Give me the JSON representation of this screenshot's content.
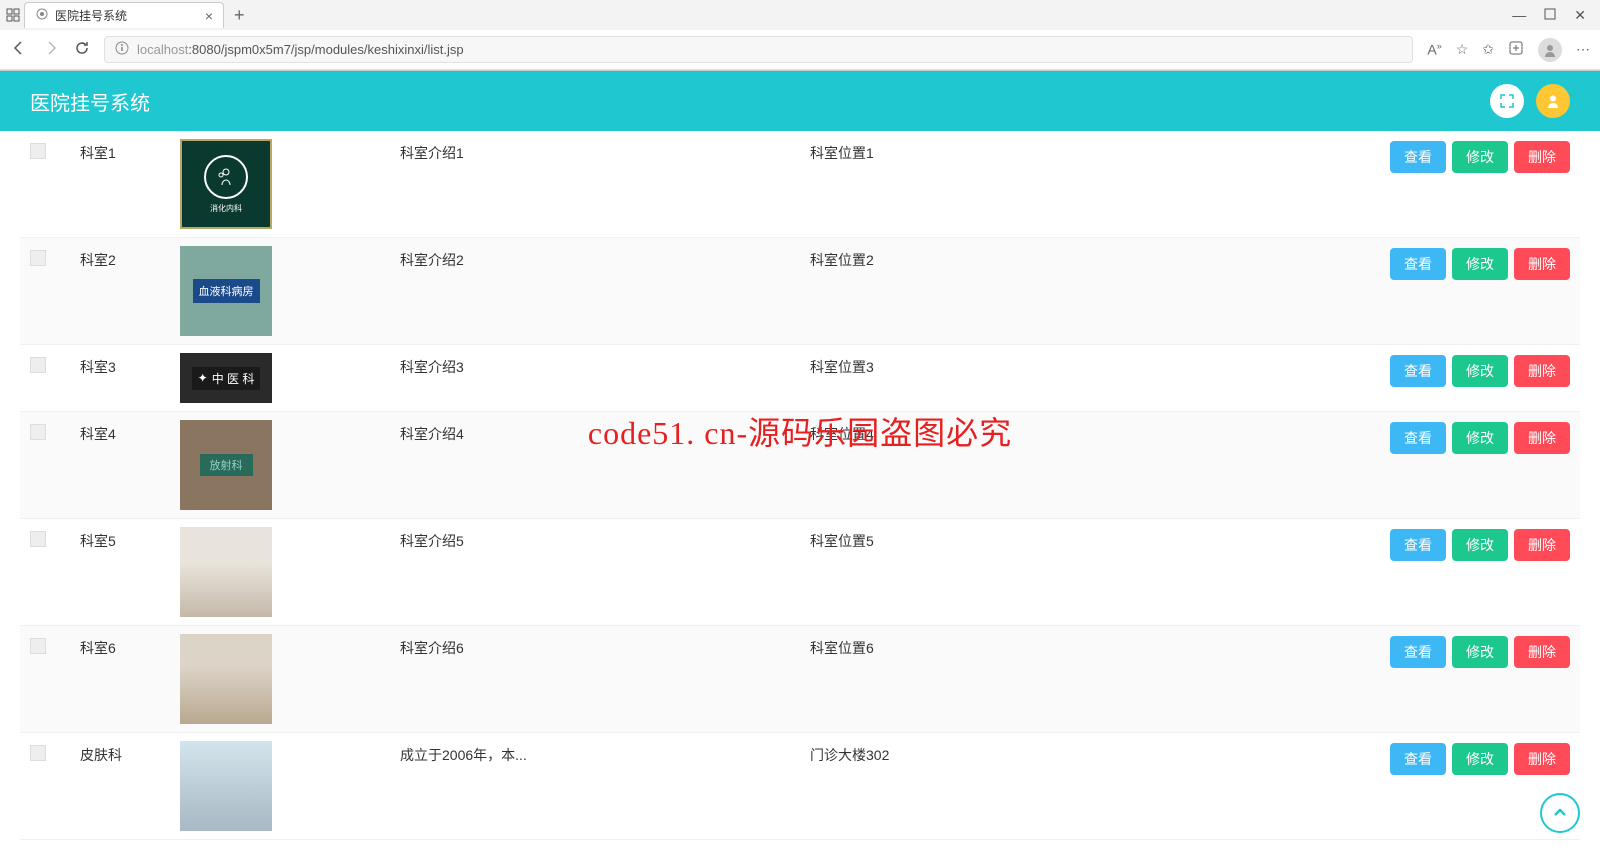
{
  "browser": {
    "tab_title": "医院挂号系统",
    "url_host": "localhost",
    "url_path": ":8080/jspm0x5m7/jsp/modules/keshixinxi/list.jsp"
  },
  "header": {
    "title": "医院挂号系统"
  },
  "actions": {
    "view": "查看",
    "edit": "修改",
    "delete": "删除"
  },
  "rows": [
    {
      "name": "科室1",
      "intro": "科室介绍1",
      "location": "科室位置1",
      "thumb_label": "消化内科"
    },
    {
      "name": "科室2",
      "intro": "科室介绍2",
      "location": "科室位置2",
      "thumb_label": "血液科病房"
    },
    {
      "name": "科室3",
      "intro": "科室介绍3",
      "location": "科室位置3",
      "thumb_label": "中 医 科"
    },
    {
      "name": "科室4",
      "intro": "科室介绍4",
      "location": "科室位置4",
      "thumb_label": "放射科"
    },
    {
      "name": "科室5",
      "intro": "科室介绍5",
      "location": "科室位置5",
      "thumb_label": ""
    },
    {
      "name": "科室6",
      "intro": "科室介绍6",
      "location": "科室位置6",
      "thumb_label": ""
    },
    {
      "name": "皮肤科",
      "intro": "成立于2006年，本...",
      "location": "门诊大楼302",
      "thumb_label": ""
    }
  ],
  "watermark": "code51. cn-源码乐园盗图必究"
}
